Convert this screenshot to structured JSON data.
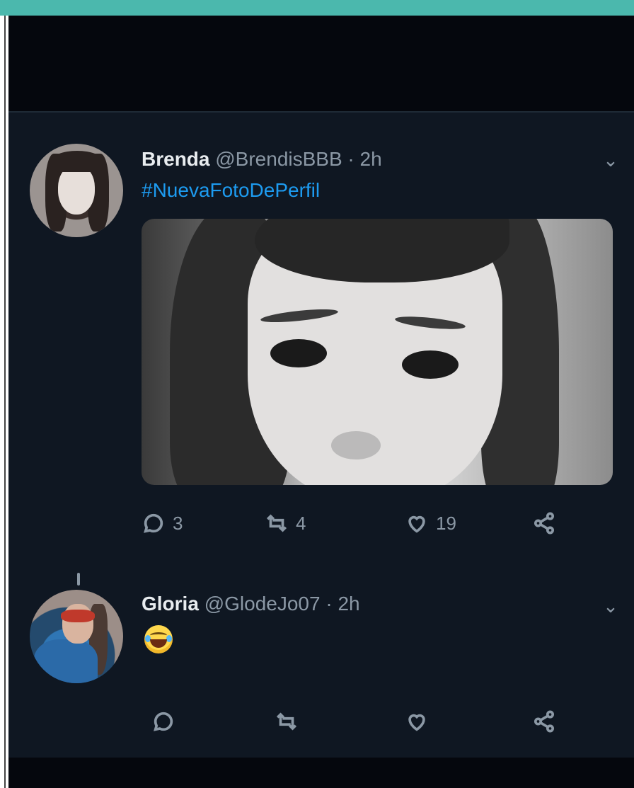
{
  "tweets": [
    {
      "display_name": "Brenda",
      "handle": "@BrendisBBB",
      "separator": "·",
      "time": "2h",
      "hashtag": "#NuevaFotoDePerfil",
      "actions": {
        "reply_count": "3",
        "retweet_count": "4",
        "like_count": "19"
      }
    },
    {
      "display_name": "Gloria",
      "handle": "@GlodeJo07",
      "separator": "·",
      "time": "2h",
      "emoji": "rolling-on-floor-laughing-emoji",
      "actions": {
        "reply_count": "",
        "retweet_count": "",
        "like_count": ""
      }
    }
  ],
  "icons": {
    "reply": "reply-icon",
    "retweet": "retweet-icon",
    "like": "like-icon",
    "share": "share-icon",
    "more": "chevron-down-icon"
  },
  "colors": {
    "top_bar": "#4bb8ad",
    "background": "#0f1722",
    "link": "#1d9bf0",
    "secondary_text": "#8b98a5",
    "primary_text": "#e8ecef"
  }
}
